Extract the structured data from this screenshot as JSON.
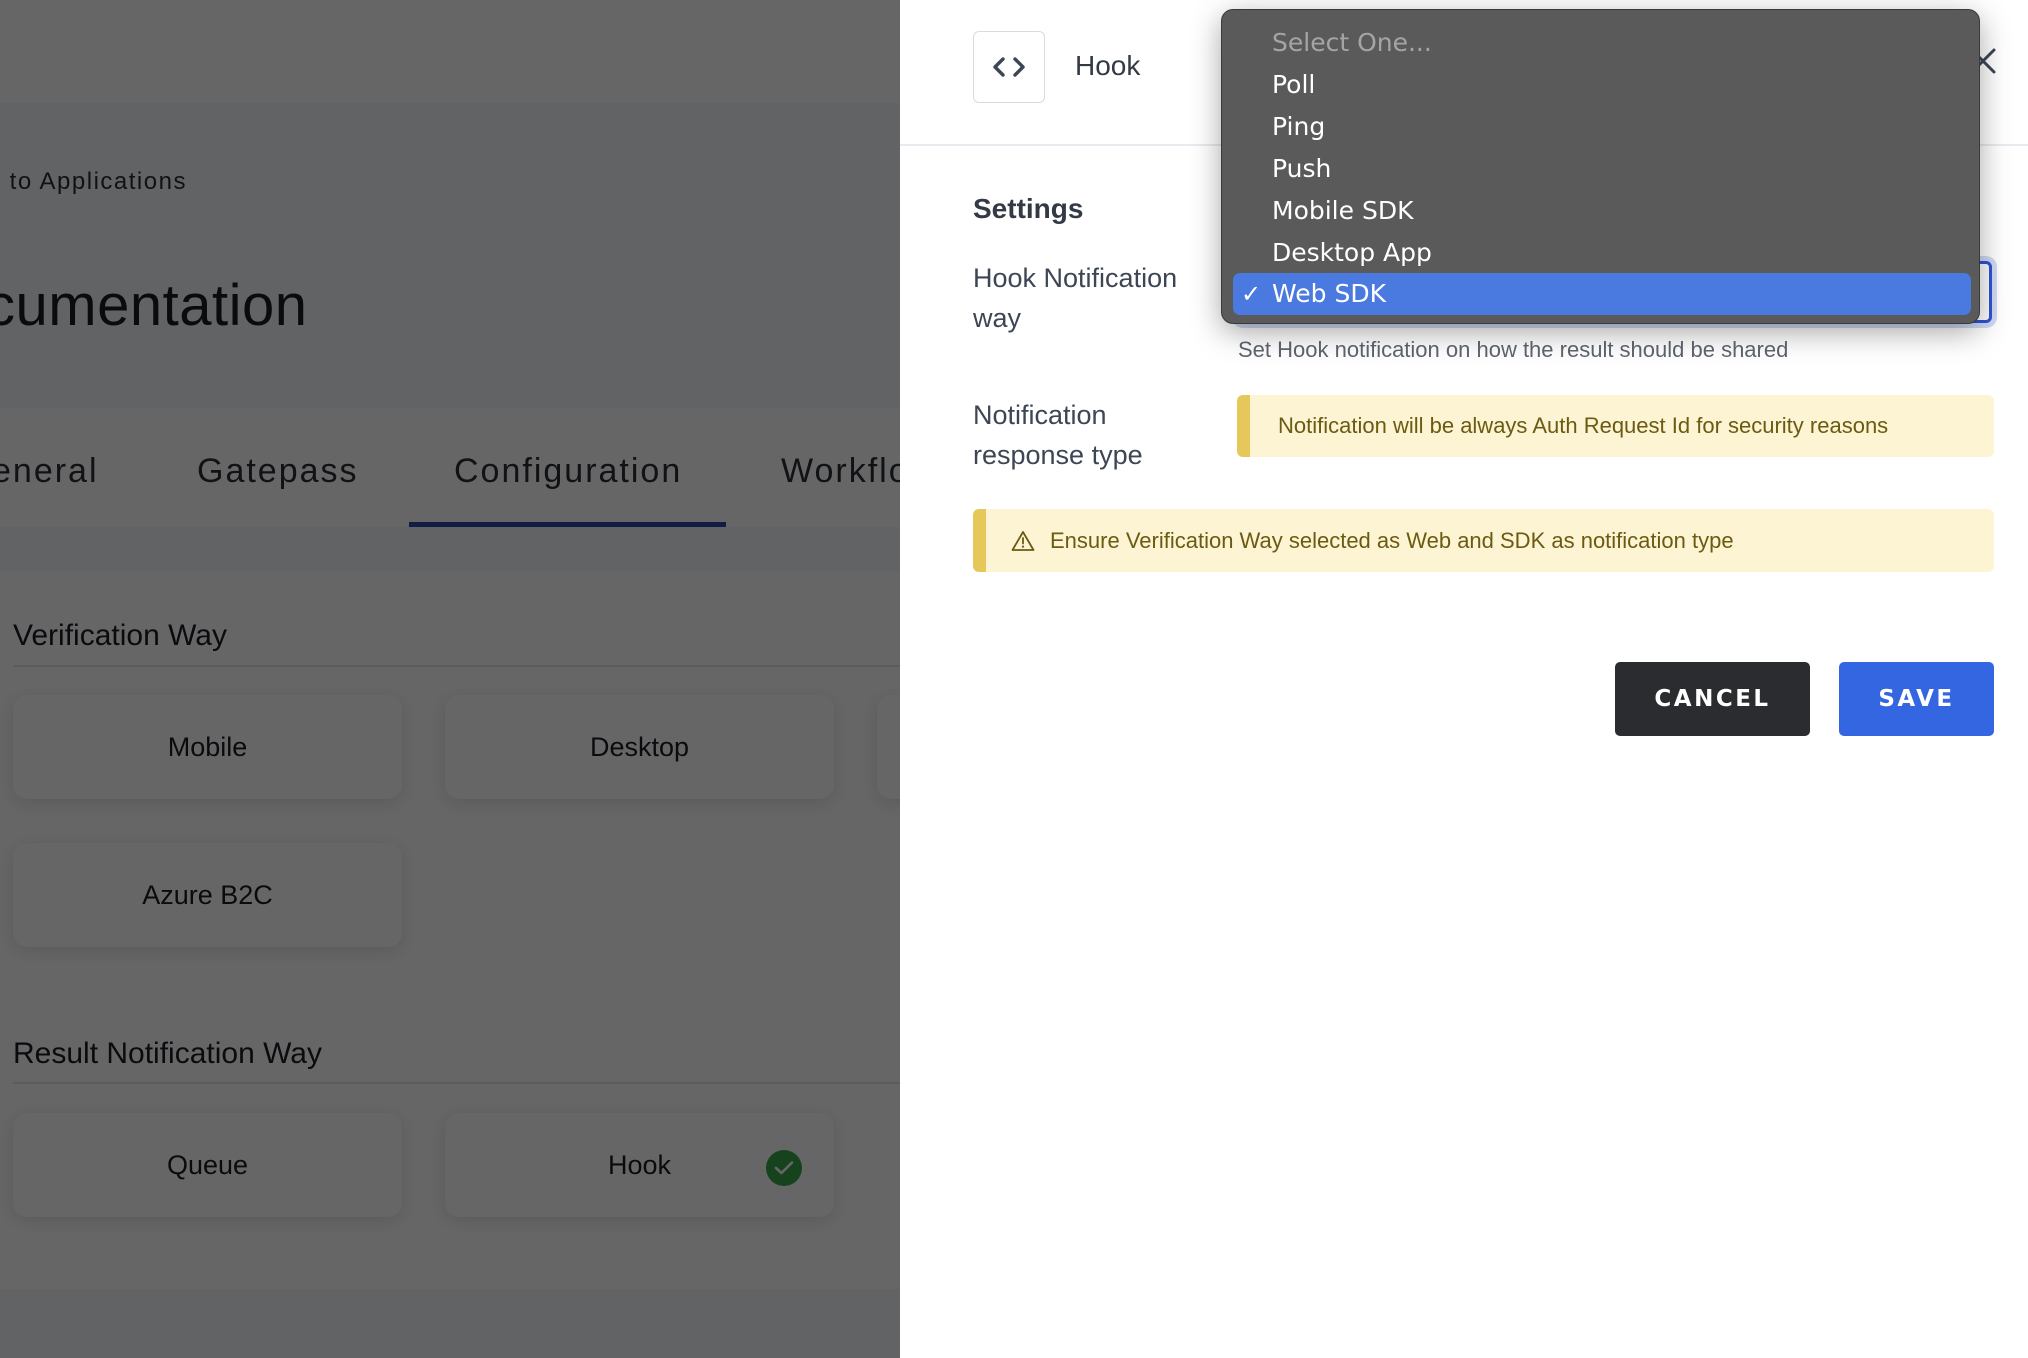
{
  "background": {
    "breadcrumb": "k to Applications",
    "page_title": "cumentation",
    "tabs": [
      {
        "label": "eneral",
        "active": false
      },
      {
        "label": "Gatepass",
        "active": false
      },
      {
        "label": "Configuration",
        "active": true
      },
      {
        "label": "Workflo",
        "active": false
      }
    ],
    "verification_way": {
      "title": "Verification Way",
      "options": [
        {
          "label": "Mobile",
          "selected": false
        },
        {
          "label": "Desktop",
          "selected": false
        },
        {
          "label": "",
          "selected": false
        },
        {
          "label": "Azure B2C",
          "selected": false
        }
      ]
    },
    "result_notification_way": {
      "title": "Result Notification Way",
      "options": [
        {
          "label": "Queue",
          "selected": false
        },
        {
          "label": "Hook",
          "selected": true
        }
      ]
    }
  },
  "panel": {
    "header": {
      "icon": "code-icon",
      "title": "Hook",
      "close_icon": "close-icon"
    },
    "settings_title": "Settings",
    "fields": {
      "hook_notification_way": {
        "label": "Hook Notification way",
        "value": "Web SDK",
        "hint": "Set Hook notification on how the result should be shared"
      },
      "notification_response_type": {
        "label": "Notification response type",
        "info": "Notification will be always Auth Request Id for security reasons"
      }
    },
    "warning": {
      "icon": "warning-triangle-icon",
      "text": "Ensure Verification Way selected as Web and SDK as notification type"
    },
    "buttons": {
      "cancel": "CANCEL",
      "save": "SAVE"
    }
  },
  "dropdown": {
    "placeholder": "Select One...",
    "options": [
      "Poll",
      "Ping",
      "Push",
      "Mobile SDK",
      "Desktop App",
      "Web SDK"
    ],
    "selected": "Web SDK",
    "check_glyph": "✓"
  },
  "colors": {
    "primary": "#3366e0",
    "cancel": "#2b2c2f",
    "focus_border": "#2e55d4",
    "callout_bg": "#fdf4d3",
    "callout_bar": "#e6c85a",
    "success": "#38a84a",
    "menu_bg": "#5a5a5a",
    "menu_highlight": "#4a7ae0"
  }
}
